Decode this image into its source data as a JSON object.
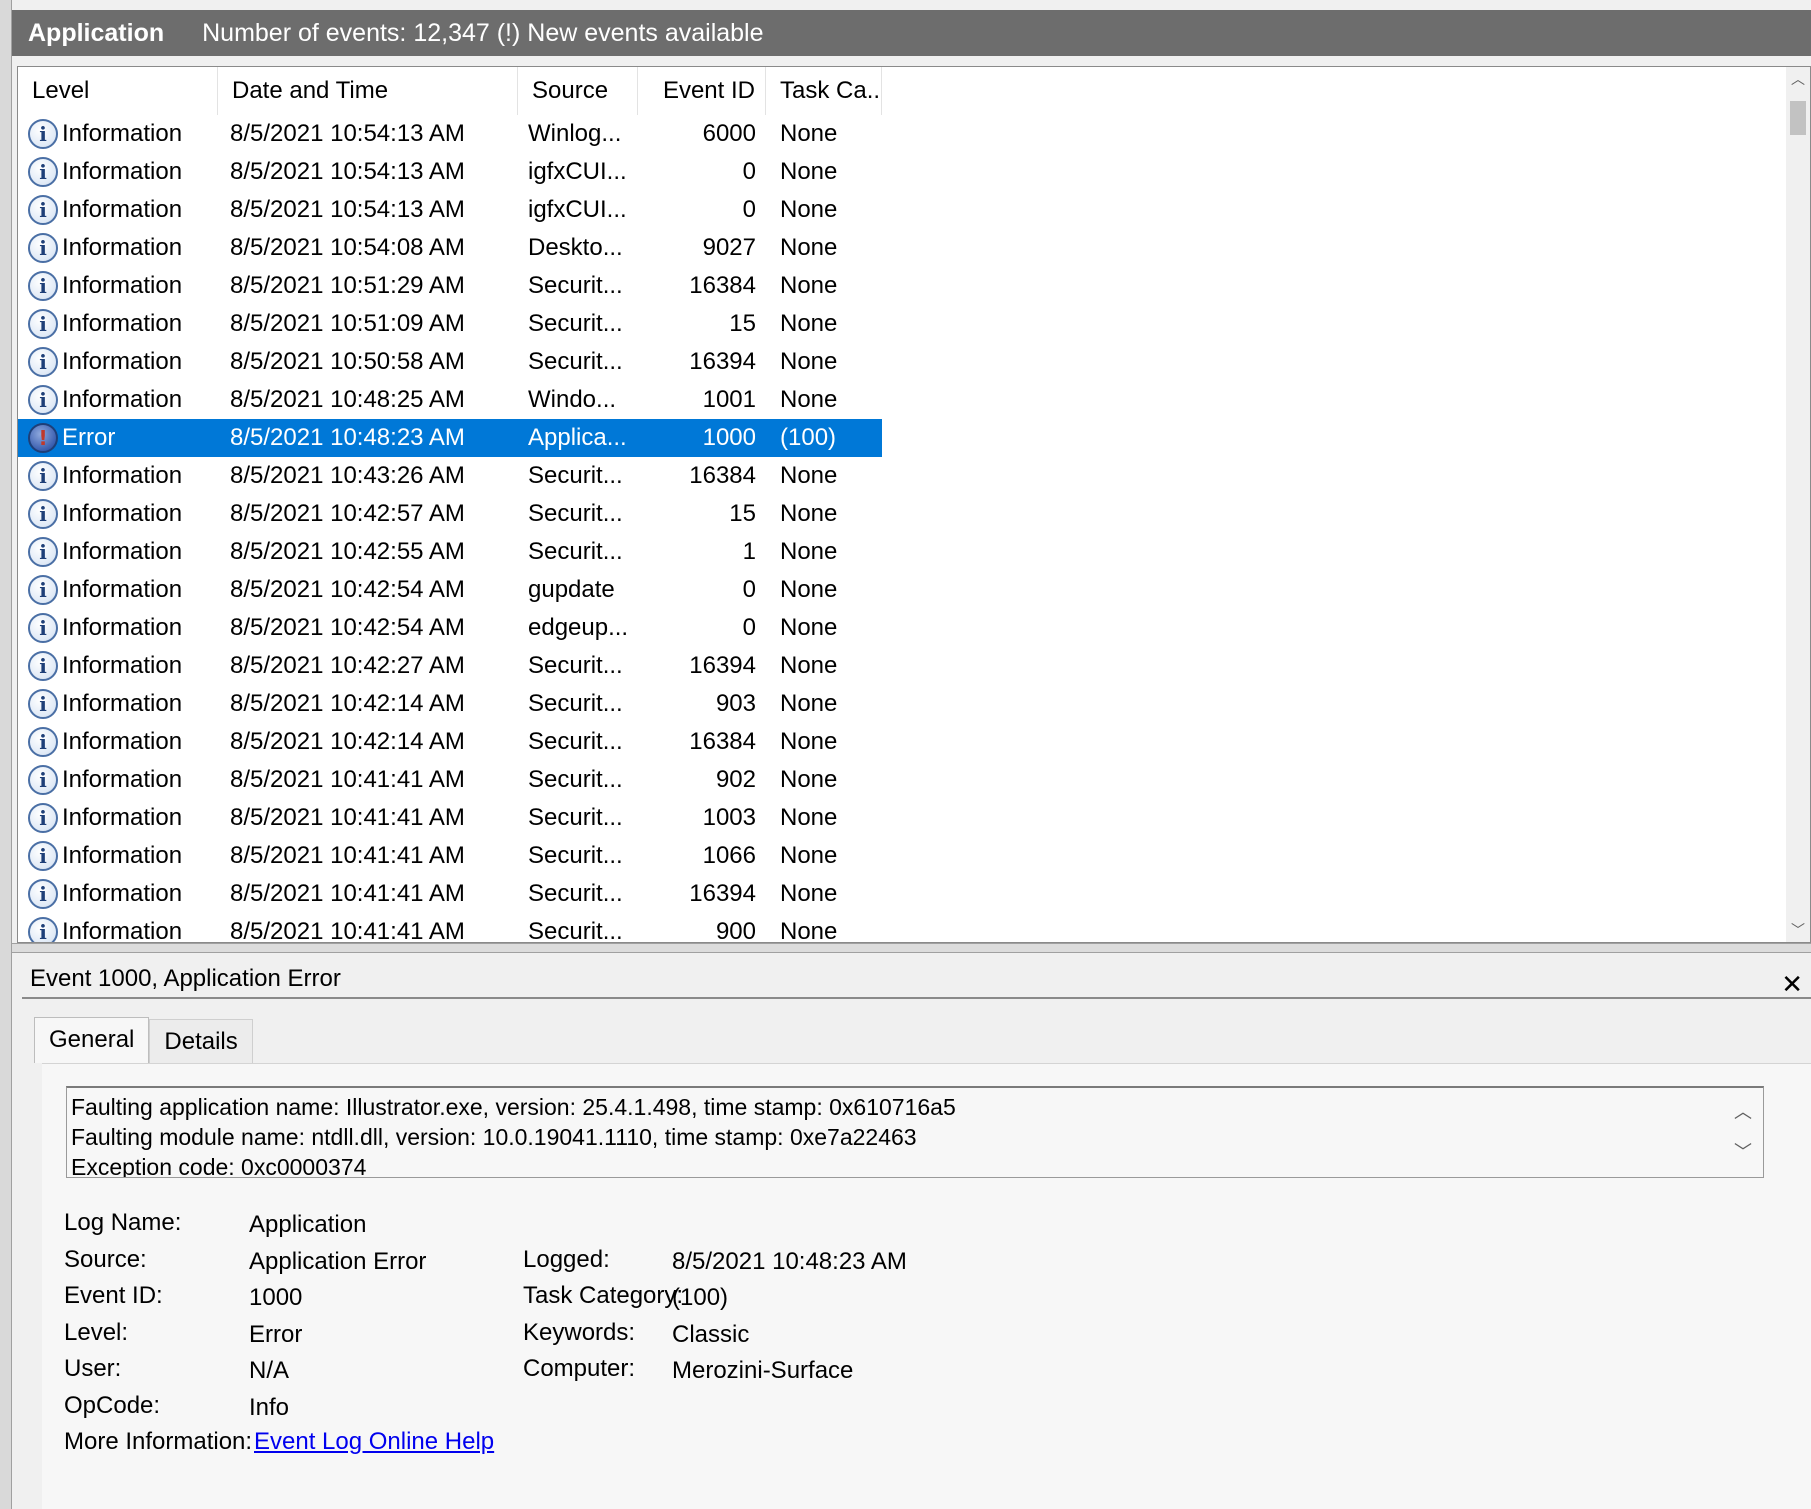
{
  "titlebar": {
    "log_name": "Application",
    "info": "Number of events: 12,347 (!) New events available"
  },
  "grid": {
    "columns": [
      "Level",
      "Date and Time",
      "Source",
      "Event ID",
      "Task Ca..."
    ],
    "rows": [
      {
        "level": "Information",
        "date": "8/5/2021 10:54:13 AM",
        "source": "Winlog...",
        "id": "6000",
        "task": "None"
      },
      {
        "level": "Information",
        "date": "8/5/2021 10:54:13 AM",
        "source": "igfxCUI...",
        "id": "0",
        "task": "None"
      },
      {
        "level": "Information",
        "date": "8/5/2021 10:54:13 AM",
        "source": "igfxCUI...",
        "id": "0",
        "task": "None"
      },
      {
        "level": "Information",
        "date": "8/5/2021 10:54:08 AM",
        "source": "Deskto...",
        "id": "9027",
        "task": "None"
      },
      {
        "level": "Information",
        "date": "8/5/2021 10:51:29 AM",
        "source": "Securit...",
        "id": "16384",
        "task": "None"
      },
      {
        "level": "Information",
        "date": "8/5/2021 10:51:09 AM",
        "source": "Securit...",
        "id": "15",
        "task": "None"
      },
      {
        "level": "Information",
        "date": "8/5/2021 10:50:58 AM",
        "source": "Securit...",
        "id": "16394",
        "task": "None"
      },
      {
        "level": "Information",
        "date": "8/5/2021 10:48:25 AM",
        "source": "Windo...",
        "id": "1001",
        "task": "None"
      },
      {
        "level": "Error",
        "date": "8/5/2021 10:48:23 AM",
        "source": "Applica...",
        "id": "1000",
        "task": "(100)",
        "selected": true
      },
      {
        "level": "Information",
        "date": "8/5/2021 10:43:26 AM",
        "source": "Securit...",
        "id": "16384",
        "task": "None"
      },
      {
        "level": "Information",
        "date": "8/5/2021 10:42:57 AM",
        "source": "Securit...",
        "id": "15",
        "task": "None"
      },
      {
        "level": "Information",
        "date": "8/5/2021 10:42:55 AM",
        "source": "Securit...",
        "id": "1",
        "task": "None"
      },
      {
        "level": "Information",
        "date": "8/5/2021 10:42:54 AM",
        "source": "gupdate",
        "id": "0",
        "task": "None"
      },
      {
        "level": "Information",
        "date": "8/5/2021 10:42:54 AM",
        "source": "edgeup...",
        "id": "0",
        "task": "None"
      },
      {
        "level": "Information",
        "date": "8/5/2021 10:42:27 AM",
        "source": "Securit...",
        "id": "16394",
        "task": "None"
      },
      {
        "level": "Information",
        "date": "8/5/2021 10:42:14 AM",
        "source": "Securit...",
        "id": "903",
        "task": "None"
      },
      {
        "level": "Information",
        "date": "8/5/2021 10:42:14 AM",
        "source": "Securit...",
        "id": "16384",
        "task": "None"
      },
      {
        "level": "Information",
        "date": "8/5/2021 10:41:41 AM",
        "source": "Securit...",
        "id": "902",
        "task": "None"
      },
      {
        "level": "Information",
        "date": "8/5/2021 10:41:41 AM",
        "source": "Securit...",
        "id": "1003",
        "task": "None"
      },
      {
        "level": "Information",
        "date": "8/5/2021 10:41:41 AM",
        "source": "Securit...",
        "id": "1066",
        "task": "None"
      },
      {
        "level": "Information",
        "date": "8/5/2021 10:41:41 AM",
        "source": "Securit...",
        "id": "16394",
        "task": "None"
      },
      {
        "level": "Information",
        "date": "8/5/2021 10:41:41 AM",
        "source": "Securit...",
        "id": "900",
        "task": "None"
      }
    ]
  },
  "detail": {
    "title": "Event 1000, Application Error",
    "close_glyph": "✕",
    "tabs": [
      "General",
      "Details"
    ],
    "description_lines": [
      "Faulting application name: Illustrator.exe, version: 25.4.1.498, time stamp: 0x610716a5",
      "Faulting module name: ntdll.dll, version: 10.0.19041.1110, time stamp: 0xe7a22463",
      "Exception code: 0xc0000374"
    ],
    "labels": {
      "log_name": "Log Name:",
      "source": "Source:",
      "event_id": "Event ID:",
      "level": "Level:",
      "user": "User:",
      "opcode": "OpCode:",
      "more_info": "More Information:",
      "logged": "Logged:",
      "task_category": "Task Category:",
      "keywords": "Keywords:",
      "computer": "Computer:"
    },
    "values": {
      "log_name": "Application",
      "source": "Application Error",
      "event_id": "1000",
      "level": "Error",
      "user": "N/A",
      "opcode": "Info",
      "more_info_link": "Event Log Online Help",
      "logged": "8/5/2021 10:48:23 AM",
      "task_category": "(100)",
      "keywords": "Classic",
      "computer": "Merozini-Surface"
    }
  },
  "icons": {
    "information": "information-icon",
    "error": "error-icon"
  },
  "colors": {
    "selection": "#0078d7",
    "titlebar": "#6d6d6d",
    "link": "#0000ee"
  }
}
